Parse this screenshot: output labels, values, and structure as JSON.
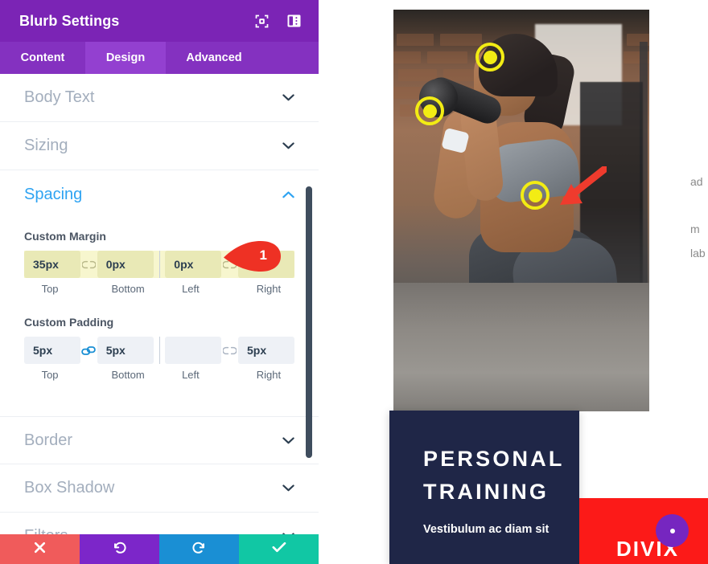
{
  "panel": {
    "title": "Blurb Settings",
    "header_icons": [
      {
        "name": "focus-target-icon"
      },
      {
        "name": "layout-panel-icon"
      }
    ],
    "tabs": [
      {
        "label": "Content",
        "active": false
      },
      {
        "label": "Design",
        "active": true
      },
      {
        "label": "Advanced",
        "active": false
      }
    ],
    "sections": [
      {
        "label": "Body Text",
        "open": false,
        "chevron": "chevron-down"
      },
      {
        "label": "Sizing",
        "open": false,
        "chevron": "chevron-down"
      },
      {
        "label": "Spacing",
        "open": true,
        "chevron": "chevron-up"
      },
      {
        "label": "Border",
        "open": false,
        "chevron": "chevron-down"
      },
      {
        "label": "Box Shadow",
        "open": false,
        "chevron": "chevron-down"
      },
      {
        "label": "Filters",
        "open": false,
        "chevron": "chevron-down"
      }
    ],
    "spacing": {
      "margin": {
        "label": "Custom Margin",
        "highlighted": true,
        "top": {
          "value": "35px",
          "label": "Top"
        },
        "bottom": {
          "value": "0px",
          "label": "Bottom"
        },
        "left": {
          "value": "0px",
          "label": "Left"
        },
        "right": {
          "value": "",
          "label": "Right"
        },
        "link_left": "unlinked-chain-icon",
        "link_right": "unlinked-chain-icon"
      },
      "padding": {
        "label": "Custom Padding",
        "highlighted": false,
        "top": {
          "value": "5px",
          "label": "Top"
        },
        "bottom": {
          "value": "5px",
          "label": "Bottom"
        },
        "left": {
          "value": "",
          "label": "Left"
        },
        "right": {
          "value": "5px",
          "label": "Right"
        },
        "link_left": "linked-chain-icon",
        "link_right": "unlinked-chain-icon"
      }
    },
    "callout": {
      "number": "1",
      "color": "#ee3124"
    },
    "footer_buttons": [
      {
        "name": "cancel-button",
        "icon": "close-icon",
        "color": "#f05b5b"
      },
      {
        "name": "undo-button",
        "icon": "undo-icon",
        "color": "#7c26c9"
      },
      {
        "name": "redo-button",
        "icon": "redo-icon",
        "color": "#1a8fd4"
      },
      {
        "name": "save-button",
        "icon": "check-icon",
        "color": "#11c7a4"
      }
    ],
    "accent_color": "#2ea3f2",
    "header_color": "#7b24b5",
    "highlight_color": "#f7f6ce"
  },
  "preview": {
    "hero_image_alt": "woman doing squat with dumbbell in gym",
    "markers": [
      {
        "name": "annotation-marker-head"
      },
      {
        "name": "annotation-marker-dumbbell"
      },
      {
        "name": "annotation-marker-waist"
      }
    ],
    "arrow": {
      "name": "red-arrow-pointer",
      "color": "#ef3b2d"
    },
    "dark_card": {
      "title": "PERSONAL TRAINING",
      "subtitle": "Vestibulum ac diam sit",
      "bg": "#1f2647"
    },
    "red_card": {
      "text": "DIVIX",
      "bg": "#fc1a18"
    },
    "fab": {
      "name": "more-options-button",
      "icon": "ellipsis-icon",
      "color": "#7626c0"
    },
    "edge_texts": [
      {
        "text": "ad"
      },
      {
        "text": "m"
      },
      {
        "text": "lab"
      }
    ]
  }
}
